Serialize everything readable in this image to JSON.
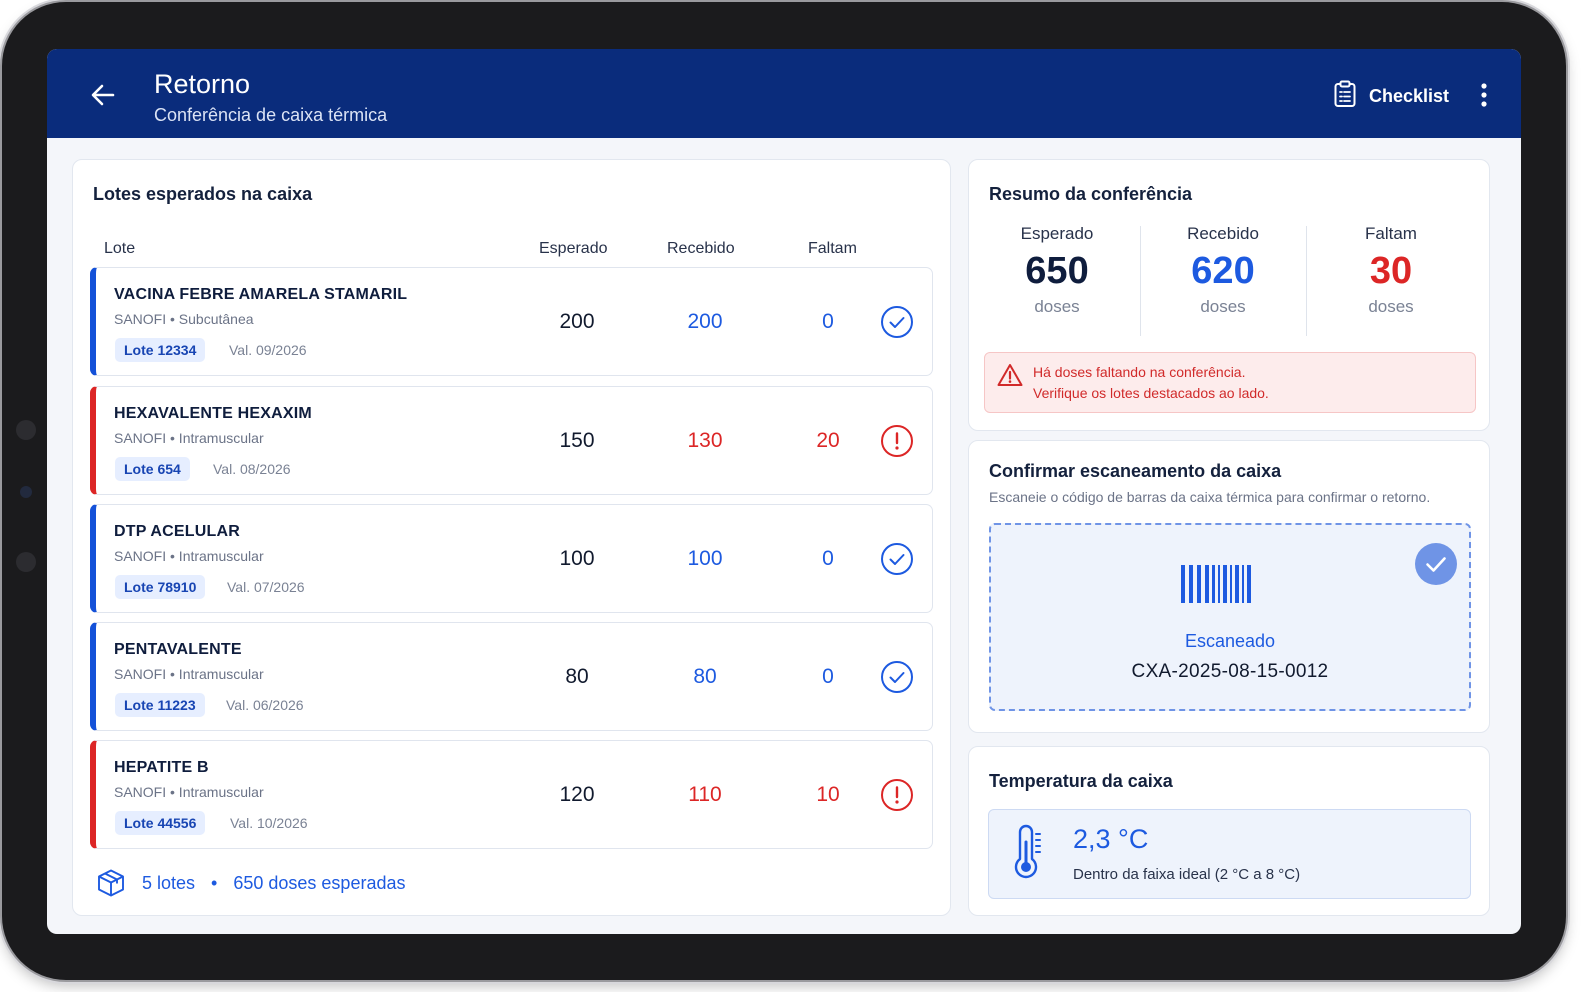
{
  "header": {
    "title": "Retorno",
    "subtitle": "Conferência de caixa térmica",
    "checklist_label": "Checklist"
  },
  "lotes": {
    "title": "Lotes esperados na caixa",
    "columns": [
      "Lote",
      "Esperado",
      "Recebido",
      "Faltam"
    ],
    "rows": [
      {
        "name": "VACINA FEBRE AMARELA STAMARIL",
        "manufacturer": "SANOFI • Subcutânea",
        "lote": "Lote 12334",
        "validade": "Val. 09/2026",
        "esperado": "200",
        "recebido": "200",
        "faltam": "0",
        "status": "ok"
      },
      {
        "name": "HEXAVALENTE HEXAXIM",
        "manufacturer": "SANOFI • Intramuscular",
        "lote": "Lote 654",
        "validade": "Val. 08/2026",
        "esperado": "150",
        "recebido": "130",
        "faltam": "20",
        "status": "alert"
      },
      {
        "name": "DTP ACELULAR",
        "manufacturer": "SANOFI • Intramuscular",
        "lote": "Lote 78910",
        "validade": "Val. 07/2026",
        "esperado": "100",
        "recebido": "100",
        "faltam": "0",
        "status": "ok"
      },
      {
        "name": "PENTAVALENTE",
        "manufacturer": "SANOFI • Intramuscular",
        "lote": "Lote 11223",
        "validade": "Val. 06/2026",
        "esperado": "80",
        "recebido": "80",
        "faltam": "0",
        "status": "ok"
      },
      {
        "name": "HEPATITE B",
        "manufacturer": "SANOFI • Intramuscular",
        "lote": "Lote 44556",
        "validade": "Val. 10/2026",
        "esperado": "120",
        "recebido": "110",
        "faltam": "10",
        "status": "alert"
      }
    ],
    "footer": {
      "count": "5 lotes",
      "separator": "•",
      "total": "650 doses esperadas"
    }
  },
  "resumo": {
    "title": "Resumo da conferência",
    "stats": [
      {
        "label": "Esperado",
        "value": "650",
        "unit": "doses",
        "color": "#0f1d3d"
      },
      {
        "label": "Recebido",
        "value": "620",
        "unit": "doses",
        "color": "#1d5ae0"
      },
      {
        "label": "Faltam",
        "value": "30",
        "unit": "doses",
        "color": "#dc2626"
      }
    ],
    "alert_line1": "Há doses faltando na conferência.",
    "alert_line2": "Verifique os lotes destacados ao lado."
  },
  "scan": {
    "title": "Confirmar escaneamento da caixa",
    "subtitle": "Escaneie o código de barras da caixa térmica para confirmar o retorno.",
    "status": "Escaneado",
    "code": "CXA-2025-08-15-0012"
  },
  "temperatura": {
    "title": "Temperatura da caixa",
    "value": "2,3 °C",
    "description": "Dentro da faixa ideal (2 °C a 8 °C)"
  },
  "colors": {
    "primary": "#0a2c7c",
    "accent": "#1d5ae0",
    "danger": "#dc2626"
  }
}
